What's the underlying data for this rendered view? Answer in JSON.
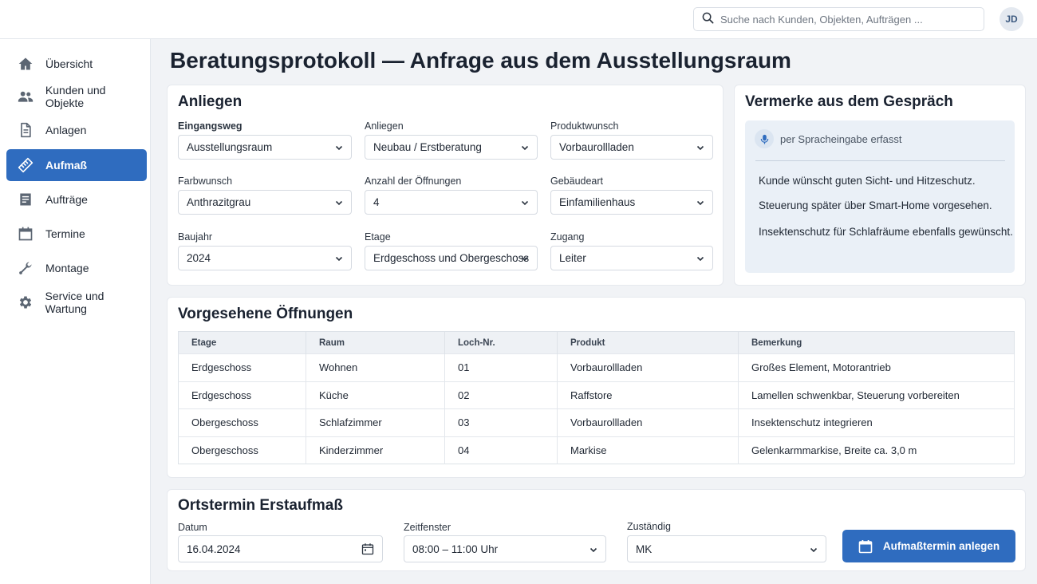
{
  "search": {
    "placeholder": "Suche nach Kunden, Objekten, Aufträgen ..."
  },
  "user": {
    "initials": "JD"
  },
  "sidebar": {
    "items": [
      {
        "label": "Übersicht",
        "icon": "home-icon"
      },
      {
        "label": "Kunden und Objekte",
        "icon": "people-icon"
      },
      {
        "label": "Anlagen",
        "icon": "document-icon"
      },
      {
        "label": "Aufmaß",
        "icon": "ruler-icon",
        "active": true
      },
      {
        "label": "Aufträge",
        "icon": "orders-icon"
      },
      {
        "label": "Termine",
        "icon": "calendar-icon"
      },
      {
        "label": "Montage",
        "icon": "wrench-icon"
      },
      {
        "label": "Service und Wartung",
        "icon": "gear-icon"
      }
    ]
  },
  "page": {
    "title": "Beratungsprotokoll",
    "subtitle": "— Anfrage aus dem Ausstellungsraum"
  },
  "anliegen": {
    "title": "Anliegen",
    "fields": [
      {
        "label": "Eingangsweg",
        "value": "Ausstellungsraum"
      },
      {
        "label": "Anliegen",
        "value": "Neubau / Erstberatung"
      },
      {
        "label": "Produktwunsch",
        "value": "Vorbaurollladen"
      },
      {
        "label": "Farbwunsch",
        "value": "Anthrazitgrau"
      },
      {
        "label": "Anzahl der Öffnungen",
        "value": "4"
      },
      {
        "label": "Gebäudeart",
        "value": "Einfamilienhaus"
      },
      {
        "label": "Baujahr",
        "value": "2024"
      },
      {
        "label": "Etage",
        "value": "Erdgeschoss und Obergeschoss"
      },
      {
        "label": "Zugang",
        "value": "Leiter"
      }
    ]
  },
  "vermerke": {
    "title": "Vermerke aus dem Gespräch",
    "voice_label": "per Spracheingabe erfasst",
    "notes": [
      "Kunde wünscht guten Sicht- und Hitzeschutz.",
      "Steuerung später über Smart-Home vorgesehen.",
      "Insektenschutz für Schlafräume ebenfalls gewünscht."
    ]
  },
  "oeffnungen": {
    "title": "Vorgesehene Öffnungen",
    "columns": [
      "Etage",
      "Raum",
      "Loch-Nr.",
      "Produkt",
      "Bemerkung"
    ],
    "rows": [
      [
        "Erdgeschoss",
        "Wohnen",
        "01",
        "Vorbaurollladen",
        "Großes Element, Motorantrieb"
      ],
      [
        "Erdgeschoss",
        "Küche",
        "02",
        "Raffstore",
        "Lamellen schwenkbar, Steuerung vorbereiten"
      ],
      [
        "Obergeschoss",
        "Schlafzimmer",
        "03",
        "Vorbaurollladen",
        "Insektenschutz integrieren"
      ],
      [
        "Obergeschoss",
        "Kinderzimmer",
        "04",
        "Markise",
        "Gelenkarmmarkise, Breite ca. 3,0 m"
      ]
    ]
  },
  "ortstermin": {
    "title": "Ortstermin Erstaufmaß",
    "date_label": "Datum",
    "date_value": "16.04.2024",
    "time_label": "Zeitfenster",
    "time_value": "08:00 – 11:00 Uhr",
    "owner_label": "Zuständig",
    "owner_value": "MK",
    "button_label": "Aufmaßtermin anlegen"
  },
  "colors": {
    "accent": "#2f6cbf",
    "background": "#f1f3f6",
    "note_box": "#eaf0f7"
  }
}
